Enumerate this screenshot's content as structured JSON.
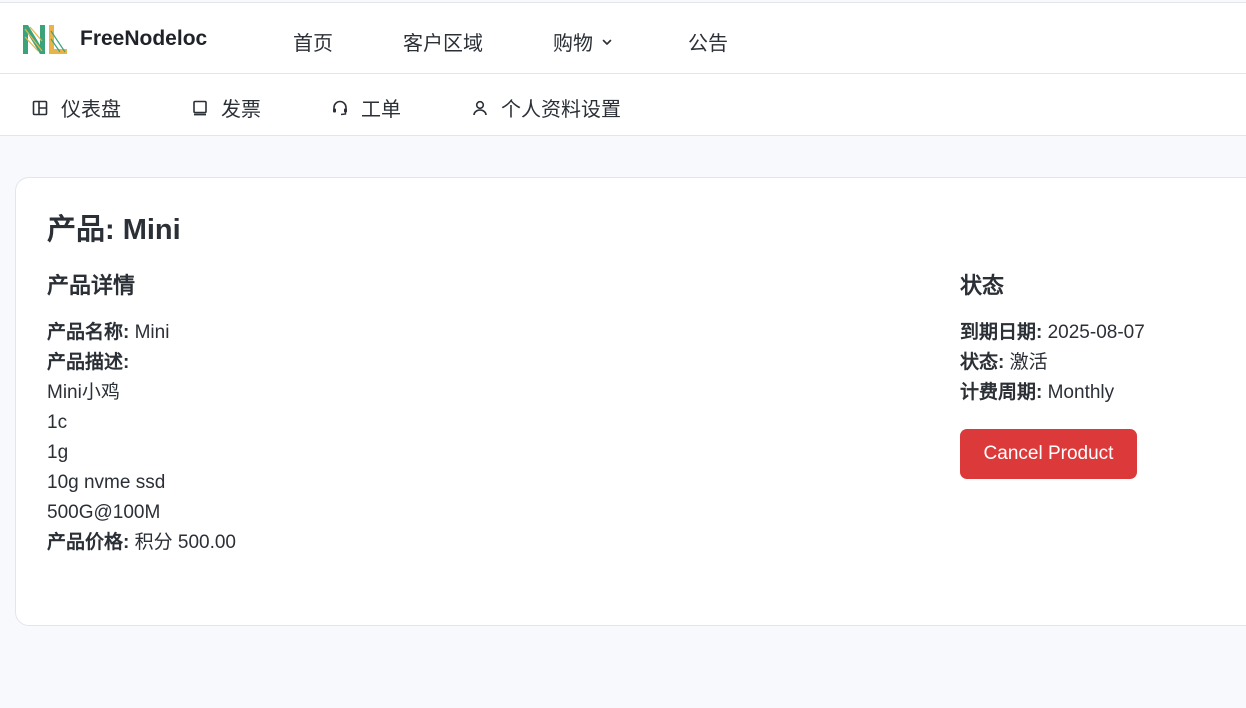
{
  "brand": {
    "name": "FreeNodeloc",
    "logo_letters": "NL"
  },
  "top_nav": {
    "items": [
      {
        "label": "首页"
      },
      {
        "label": "客户区域"
      },
      {
        "label": "购物",
        "icon": "chevron-down-icon"
      },
      {
        "label": "公告"
      }
    ]
  },
  "sub_nav": {
    "items": [
      {
        "label": "仪表盘",
        "icon": "dashboard-icon"
      },
      {
        "label": "发票",
        "icon": "invoice-icon"
      },
      {
        "label": "工单",
        "icon": "headset-icon"
      },
      {
        "label": "个人资料设置",
        "icon": "user-icon"
      }
    ]
  },
  "product": {
    "title": "产品: Mini",
    "details": {
      "heading": "产品详情",
      "name_label": "产品名称:",
      "name_value": "Mini",
      "desc_label": "产品描述:",
      "desc_lines": [
        "Mini小鸡",
        "1c",
        "1g",
        "10g nvme ssd",
        "500G@100M"
      ],
      "price_label": "产品价格:",
      "price_value": "积分 500.00"
    },
    "status": {
      "heading": "状态",
      "due_label": "到期日期:",
      "due_value": "2025-08-07",
      "state_label": "状态:",
      "state_value": "激活",
      "cycle_label": "计费周期:",
      "cycle_value": "Monthly"
    },
    "cancel_button": "Cancel Product"
  },
  "colors": {
    "page_bg": "#f8f9fc",
    "cancel_button": "#dc3a3a",
    "text": "#2b2f36"
  }
}
